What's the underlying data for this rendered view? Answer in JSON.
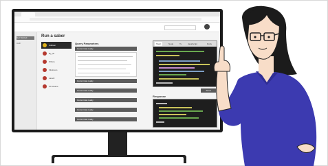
{
  "screen": {
    "page_title": "Run a saber",
    "query_panel_title": "Query Parameters",
    "response_title": "Response",
    "send_label": "Send",
    "code_tabs": [
      "Shell",
      "Node",
      "Ts",
      "JavaScript",
      "Ruby"
    ],
    "sidebar_items": [
      "Get Started",
      "Auth"
    ],
    "endpoints": [
      {
        "label": "Addsen",
        "active": true
      },
      {
        "label": "By_ID",
        "active": false
      },
      {
        "label": "Whore",
        "active": false
      },
      {
        "label": "Fitstrasm",
        "active": false
      },
      {
        "label": "Laneft",
        "active": false
      },
      {
        "label": "Oft Hoane",
        "active": false
      }
    ],
    "collapsed_rows": [
      "Commi dan ready",
      "Commi dan ready",
      "Commi dan ready",
      "Commi dan ready",
      "Commi dan ready",
      "Commi dan ready"
    ]
  },
  "colors": {
    "monitor": "#1a1a1a",
    "accent_dot": "#b5392f",
    "active_dot": "#e0b21a",
    "shirt": "#3c3ab0",
    "hair": "#1b1b1b",
    "skin": "#f8ddc8"
  }
}
